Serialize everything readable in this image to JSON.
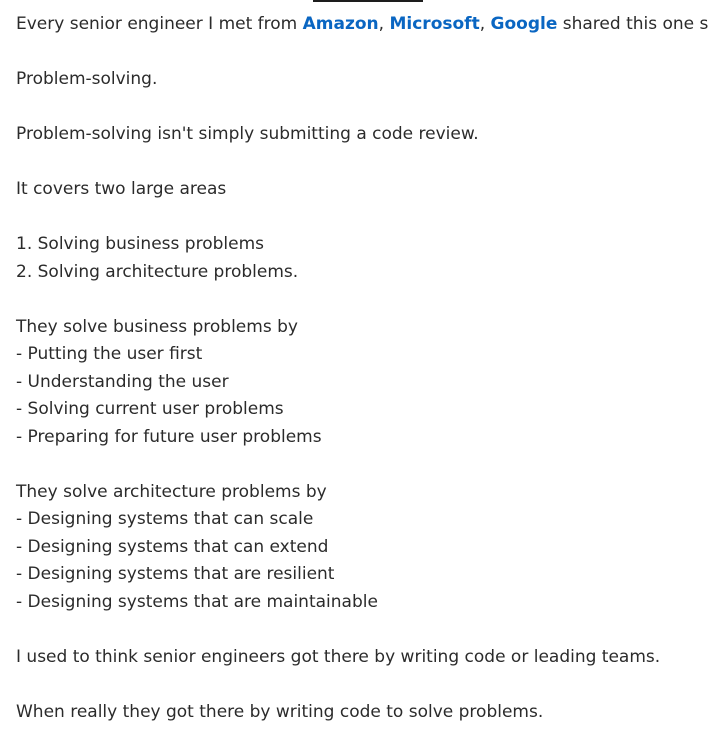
{
  "post": {
    "intro": {
      "prefix": "Every senior engineer I met from ",
      "mentions": [
        "Amazon",
        "Microsoft",
        "Google"
      ],
      "sep1": ", ",
      "sep2": ", ",
      "suffix": " shared this one skill"
    },
    "p1": "Problem-solving.",
    "p2": "Problem-solving isn't simply submitting a code review.",
    "p3": "It covers two large areas",
    "areas": [
      "1. Solving business problems",
      "2. Solving architecture problems."
    ],
    "business_title": "They solve business problems by",
    "business_items": [
      "- Putting the user first",
      "- Understanding the user",
      "- Solving current user problems",
      "- Preparing for future user problems"
    ],
    "arch_title": "They solve architecture problems by",
    "arch_items": [
      "- Designing systems that can scale",
      "- Designing systems that can extend",
      "- Designing systems that are resilient",
      "- Designing systems that are maintainable"
    ],
    "p4": "I used to think senior engineers got there by writing code or leading teams.",
    "p5": "When really they got there by writing code to solve problems."
  },
  "colors": {
    "text": "#2b2b2b",
    "mention": "#0a66c2"
  }
}
